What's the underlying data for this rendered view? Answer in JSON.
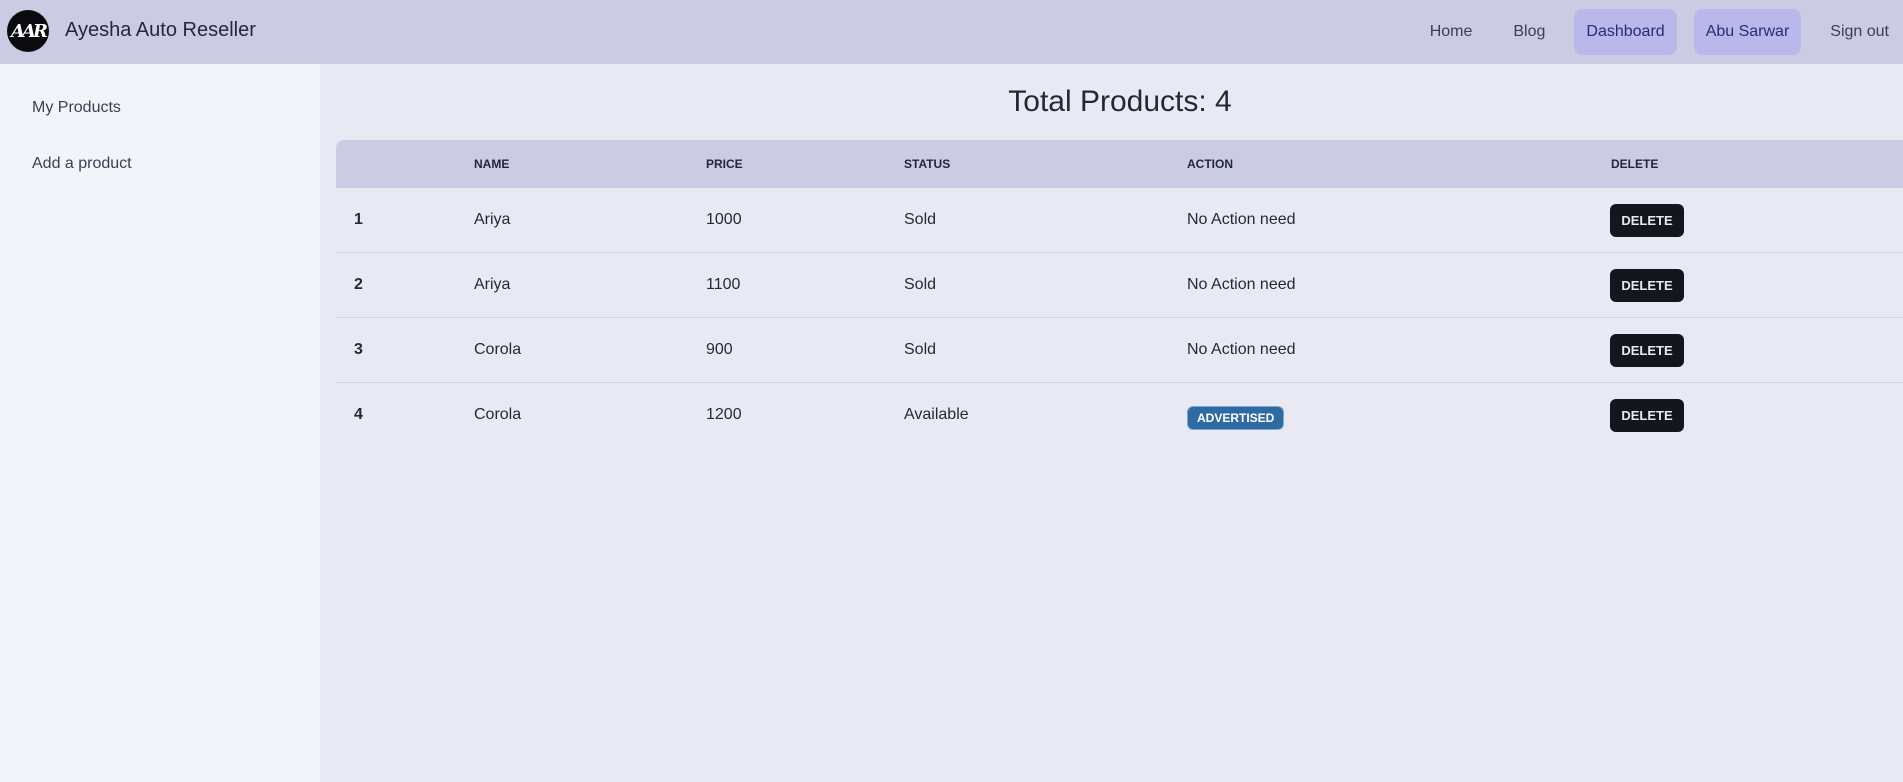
{
  "header": {
    "logo_text": "AAR",
    "brand": "Ayesha Auto Reseller",
    "nav": {
      "home": "Home",
      "blog": "Blog",
      "dashboard": "Dashboard",
      "user": "Abu Sarwar",
      "signout": "Sign out"
    }
  },
  "sidebar": {
    "items": [
      "My Products",
      "Add a product"
    ]
  },
  "main": {
    "title": "Total Products: 4",
    "columns": [
      "",
      "Name",
      "Price",
      "Status",
      "Action",
      "Delete"
    ],
    "rows": [
      {
        "idx": "1",
        "name": "Ariya",
        "price": "1000",
        "status": "Sold",
        "action": "No Action need",
        "delete": "DELETE"
      },
      {
        "idx": "2",
        "name": "Ariya",
        "price": "1100",
        "status": "Sold",
        "action": "No Action need",
        "delete": "DELETE"
      },
      {
        "idx": "3",
        "name": "Corola",
        "price": "900",
        "status": "Sold",
        "action": "No Action need",
        "delete": "DELETE"
      },
      {
        "idx": "4",
        "name": "Corola",
        "price": "1200",
        "status": "Available",
        "action": "ADVERTISED",
        "delete": "DELETE"
      }
    ]
  },
  "colors": {
    "topbar": "#cbcce3",
    "active_nav": "#b8b8ea",
    "delete_button": "#15151f",
    "advertised_badge": "#2f6aa3"
  }
}
